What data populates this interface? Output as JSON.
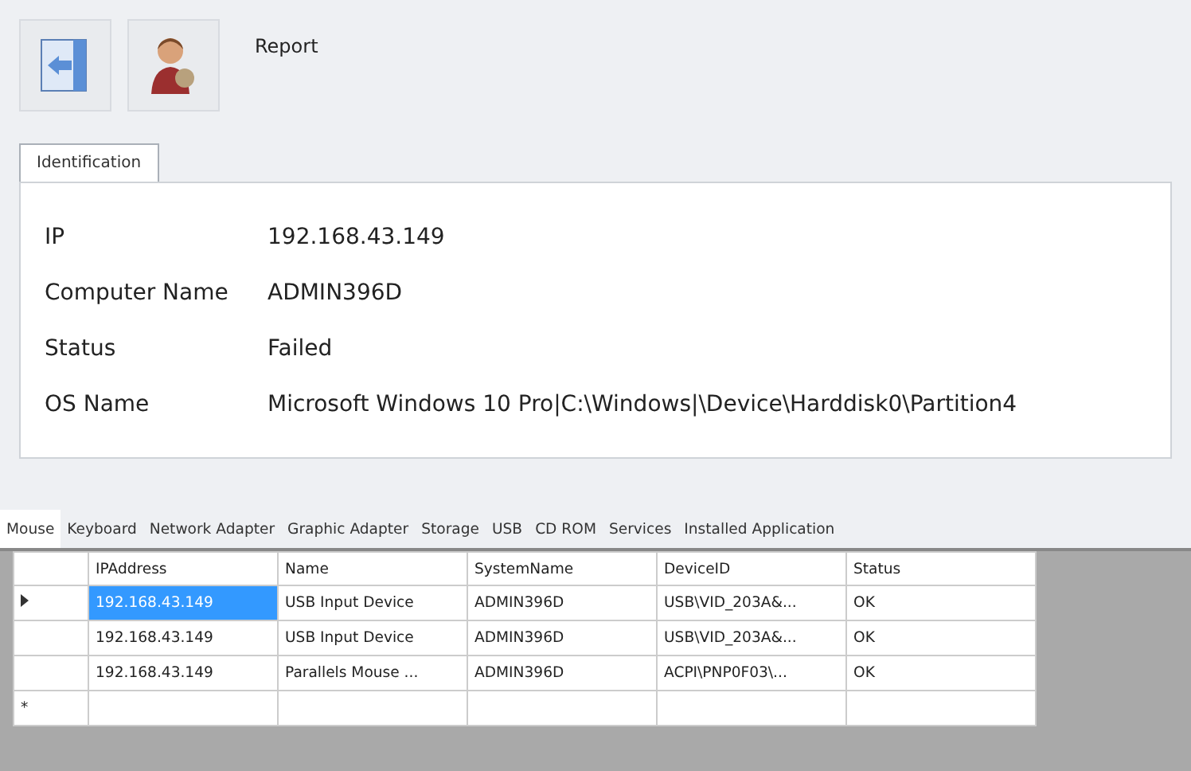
{
  "toolbar": {
    "title": "Report"
  },
  "identification": {
    "tabs": [
      {
        "label": "Identification",
        "selected": true
      }
    ],
    "fields": [
      {
        "label": "IP",
        "value": "192.168.43.149"
      },
      {
        "label": "Computer Name",
        "value": "ADMIN396D"
      },
      {
        "label": "Status",
        "value": "Failed"
      },
      {
        "label": "OS Name",
        "value": "Microsoft Windows 10 Pro|C:\\Windows|\\Device\\Harddisk0\\Partition4"
      }
    ]
  },
  "device_tabs": [
    {
      "label": "Mouse",
      "selected": true
    },
    {
      "label": "Keyboard",
      "selected": false
    },
    {
      "label": "Network Adapter",
      "selected": false
    },
    {
      "label": "Graphic Adapter",
      "selected": false
    },
    {
      "label": "Storage",
      "selected": false
    },
    {
      "label": "USB",
      "selected": false
    },
    {
      "label": "CD ROM",
      "selected": false
    },
    {
      "label": "Services",
      "selected": false
    },
    {
      "label": "Installed Application",
      "selected": false
    }
  ],
  "table": {
    "columns": [
      "IPAddress",
      "Name",
      "SystemName",
      "DeviceID",
      "Status"
    ],
    "rows": [
      {
        "selected": true,
        "cells": [
          "192.168.43.149",
          "USB Input Device",
          "ADMIN396D",
          "USB\\VID_203A&...",
          "OK"
        ]
      },
      {
        "selected": false,
        "cells": [
          "192.168.43.149",
          "USB Input Device",
          "ADMIN396D",
          "USB\\VID_203A&...",
          "OK"
        ]
      },
      {
        "selected": false,
        "cells": [
          "192.168.43.149",
          "Parallels Mouse ...",
          "ADMIN396D",
          "ACPI\\PNP0F03\\...",
          "OK"
        ]
      }
    ],
    "new_row_marker": "*"
  }
}
